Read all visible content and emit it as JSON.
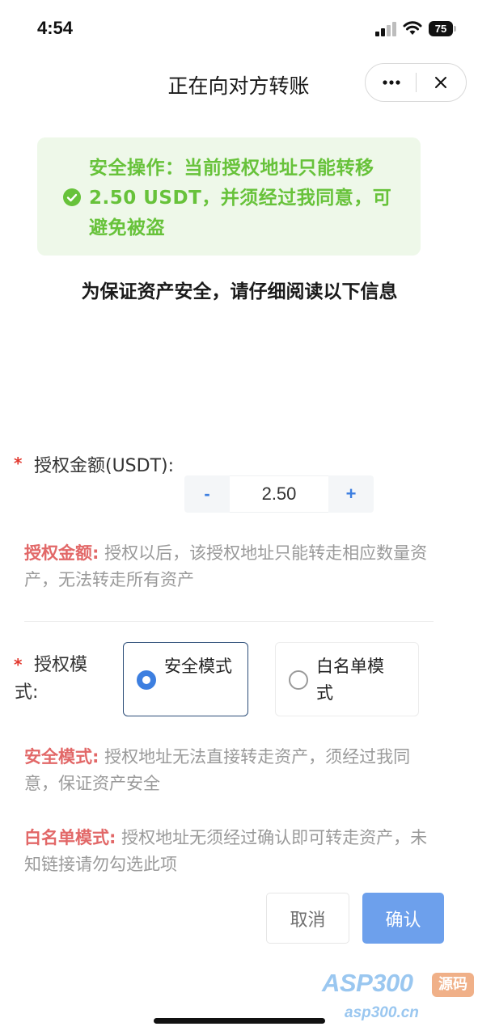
{
  "status_bar": {
    "time": "4:54",
    "battery": "75"
  },
  "header": {
    "title": "正在向对方转账"
  },
  "notice": {
    "text": "安全操作：当前授权地址只能转移2.50 USDT，并须经过我同意，可避免被盗",
    "color": "#67c23a"
  },
  "info_heading": "为保证资产安全，请仔细阅读以下信息",
  "amount": {
    "required_mark": "*",
    "label": "授权金额(USDT):",
    "minus": "-",
    "value": "2.50",
    "plus": "+",
    "desc_key": "授权金额:",
    "desc_text": " 授权以后，该授权地址只能转走相应数量资产，无法转走所有资产"
  },
  "mode": {
    "required_mark": "*",
    "label": "授权模式:",
    "options": [
      {
        "label": "安全模式",
        "selected": true
      },
      {
        "label": "白名单模式",
        "selected": false
      }
    ],
    "safe_desc_key": "安全模式:",
    "safe_desc_text": " 授权地址无法直接转走资产，须经过我同意，保证资产安全",
    "whitelist_desc_key": "白名单模式:",
    "whitelist_desc_text": " 授权地址无须经过确认即可转走资产，未知链接请勿勾选此项"
  },
  "actions": {
    "cancel": "取消",
    "confirm": "确认"
  },
  "watermark": {
    "logo": "ASP300",
    "badge": "源码",
    "url": "asp300.cn"
  },
  "colors": {
    "accent": "#3d7fe0",
    "required": "#e2382e",
    "desc_key": "#e26868",
    "confirm_button": "#6da0ec"
  }
}
